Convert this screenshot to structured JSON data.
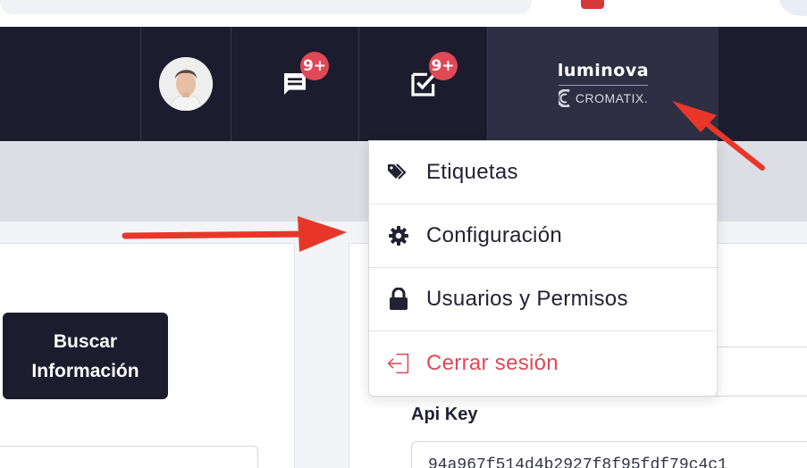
{
  "navbar": {
    "chat_badge": "9+",
    "tasks_badge": "9+",
    "brand_primary": "luminova",
    "brand_secondary": "CROMATIX.",
    "colors": {
      "navbar_bg": "#1c1c2e",
      "brand_bg": "#2e2f42",
      "badge": "#e14856"
    }
  },
  "dropdown": {
    "items": [
      {
        "label": "Etiquetas",
        "icon": "tags-icon"
      },
      {
        "label": "Configuración",
        "icon": "gear-icon"
      },
      {
        "label": "Usuarios y Permisos",
        "icon": "lock-icon"
      },
      {
        "label": "Cerrar sesión",
        "icon": "logout-icon",
        "color": "#e14856"
      }
    ]
  },
  "main": {
    "search_button_line1": "Buscar",
    "search_button_line2": "Información",
    "api_key_label": "Api Key",
    "api_key_value": "94a967f514d4b2927f8f95fdf79c4c1"
  },
  "annotations": {
    "arrow_color": "#e8372a"
  }
}
